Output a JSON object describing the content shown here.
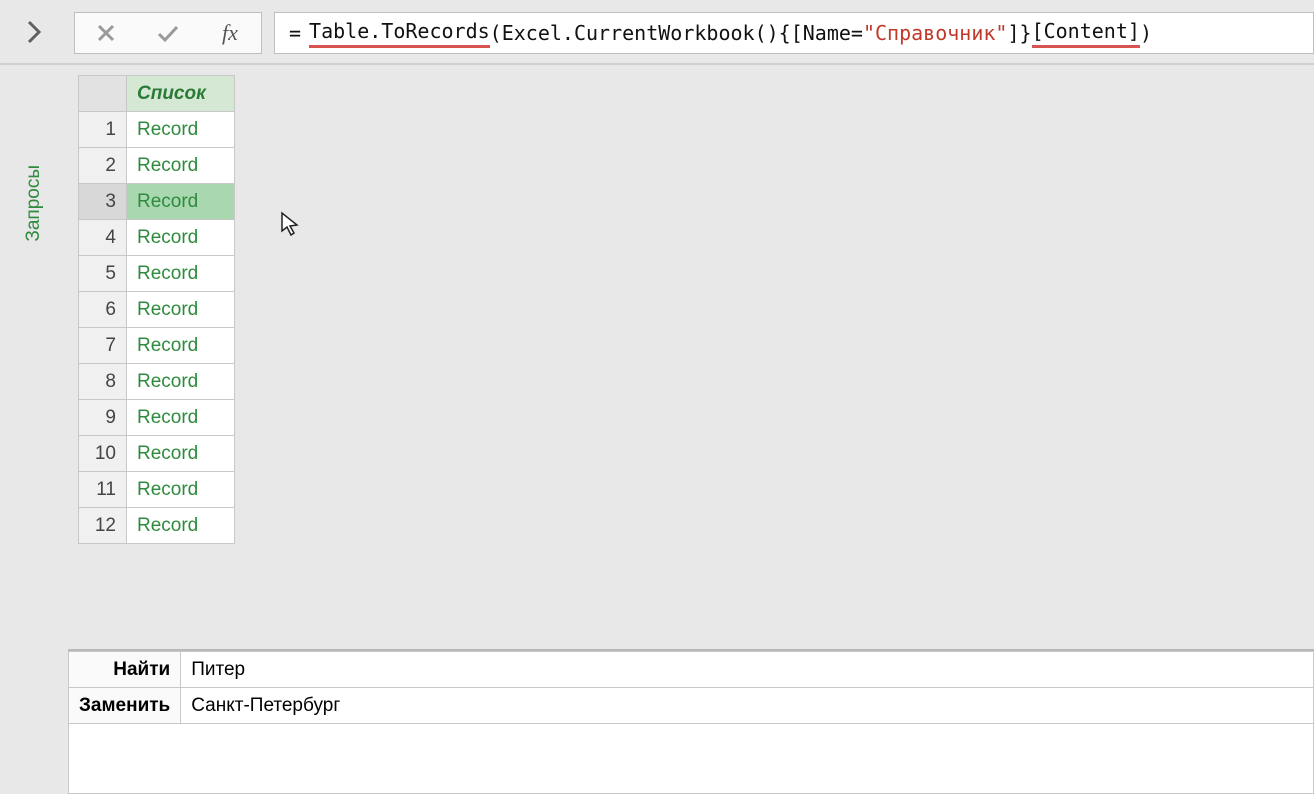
{
  "sidebar": {
    "label": "Запросы"
  },
  "formula_bar": {
    "fx_label": "fx",
    "segments": {
      "eq": "=",
      "fn1": "Table.ToRecords",
      "p1": "( ",
      "fn2": "Excel.CurrentWorkbook",
      "p2": "(){[Name=",
      "str": "\"Справочник\"",
      "p3": "]}",
      "br1": "[Content]",
      "p4": " )"
    }
  },
  "list": {
    "header": "Список",
    "selected_index": 2,
    "rows": [
      {
        "n": "1",
        "v": "Record"
      },
      {
        "n": "2",
        "v": "Record"
      },
      {
        "n": "3",
        "v": "Record"
      },
      {
        "n": "4",
        "v": "Record"
      },
      {
        "n": "5",
        "v": "Record"
      },
      {
        "n": "6",
        "v": "Record"
      },
      {
        "n": "7",
        "v": "Record"
      },
      {
        "n": "8",
        "v": "Record"
      },
      {
        "n": "9",
        "v": "Record"
      },
      {
        "n": "10",
        "v": "Record"
      },
      {
        "n": "11",
        "v": "Record"
      },
      {
        "n": "12",
        "v": "Record"
      }
    ]
  },
  "detail": {
    "rows": [
      {
        "key": "Найти",
        "value": "Питер"
      },
      {
        "key": "Заменить",
        "value": "Санкт-Петербург"
      }
    ]
  }
}
